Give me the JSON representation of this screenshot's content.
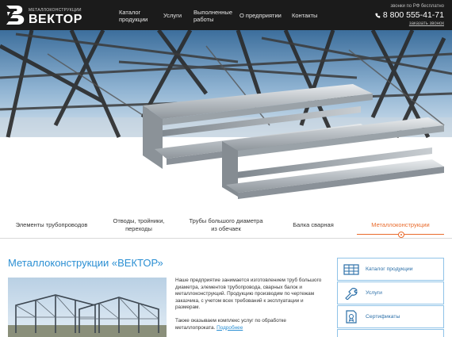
{
  "header": {
    "logo_subtitle": "МЕТАЛЛОКОНСТРУКЦИИ",
    "logo_name": "ВЕКТОР",
    "nav": [
      {
        "line1": "Каталог",
        "line2": "продукции"
      },
      {
        "line1": "Услуги",
        "line2": ""
      },
      {
        "line1": "Выполненные",
        "line2": "работы"
      },
      {
        "line1": "О предприятии",
        "line2": ""
      },
      {
        "line1": "Контакты",
        "line2": ""
      }
    ],
    "phone_note": "звонки по РФ бесплатно",
    "phone": "8 800 555-41-71",
    "callback": "заказать звонок"
  },
  "tabs": [
    {
      "line1": "Элементы трубопроводов",
      "line2": "",
      "active": false
    },
    {
      "line1": "Отводы, тройники,",
      "line2": "переходы",
      "active": false
    },
    {
      "line1": "Трубы большого диаметра",
      "line2": "из обечаек",
      "active": false
    },
    {
      "line1": "Балка сварная",
      "line2": "",
      "active": false
    },
    {
      "line1": "Металлоконструкции",
      "line2": "",
      "active": true
    }
  ],
  "main": {
    "title": "Металлоконструкции «ВЕКТОР»",
    "paragraph1": "Наше предприятие занимается изготовлением труб большого диаметра, элементов трубопровода, сварных балок и металлоконструкций. Продукцию производим по чертежам заказчика, с учетом всех требований к эксплуатации и размерам.",
    "paragraph2": "Также оказываем комплекс услуг по обработке металлопроката.",
    "more_link": "Подробнее"
  },
  "sidebar": {
    "items": [
      {
        "label": "Каталог продукции",
        "icon": "catalog-icon"
      },
      {
        "label": "Услуги",
        "icon": "services-icon"
      },
      {
        "label": "Сертификаты",
        "icon": "certificate-icon"
      }
    ]
  },
  "colors": {
    "accent_blue": "#2b8fd3",
    "accent_orange": "#e96b2c",
    "header_bg": "#1b1b1b"
  }
}
